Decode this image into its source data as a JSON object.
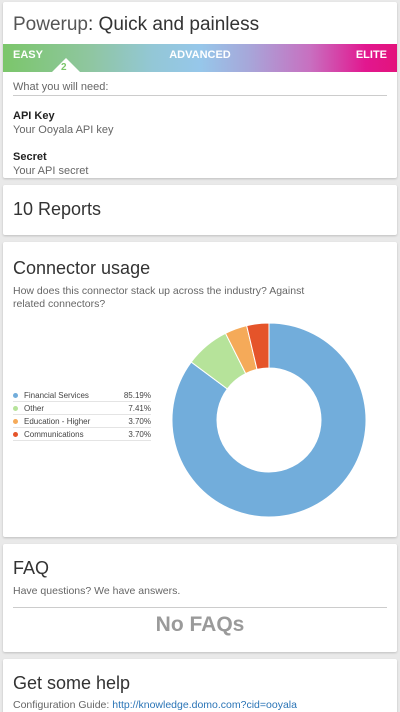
{
  "powerup": {
    "title_prefix": "Powerup",
    "title_rest": ": Quick and painless",
    "difficulty": {
      "easy": "EASY",
      "advanced": "ADVANCED",
      "elite": "ELITE",
      "level": "2"
    },
    "need_label": "What you will need:",
    "requirements": [
      {
        "name": "API Key",
        "desc": "Your Ooyala API key"
      },
      {
        "name": "Secret",
        "desc": "Your API secret"
      }
    ]
  },
  "reports": {
    "title": "10 Reports"
  },
  "usage": {
    "title": "Connector usage",
    "subtitle": "How does this connector stack up across the industry? Against related connectors?"
  },
  "chart_data": {
    "type": "pie",
    "donut": true,
    "categories": [
      "Financial Services",
      "Other",
      "Education - Higher",
      "Communications"
    ],
    "values": [
      85.19,
      7.41,
      3.7,
      3.7
    ],
    "labels": [
      "85.19%",
      "7.41%",
      "3.70%",
      "3.70%"
    ],
    "colors": [
      "#72addb",
      "#b6e39a",
      "#f5aa59",
      "#e5542a"
    ],
    "legend": "left"
  },
  "faq": {
    "title": "FAQ",
    "subtitle": "Have questions? We have answers.",
    "empty": "No FAQs"
  },
  "help": {
    "title": "Get some help",
    "guide_label": "Configuration Guide: ",
    "guide_url": "http://knowledge.domo.com?cid=ooyala"
  }
}
